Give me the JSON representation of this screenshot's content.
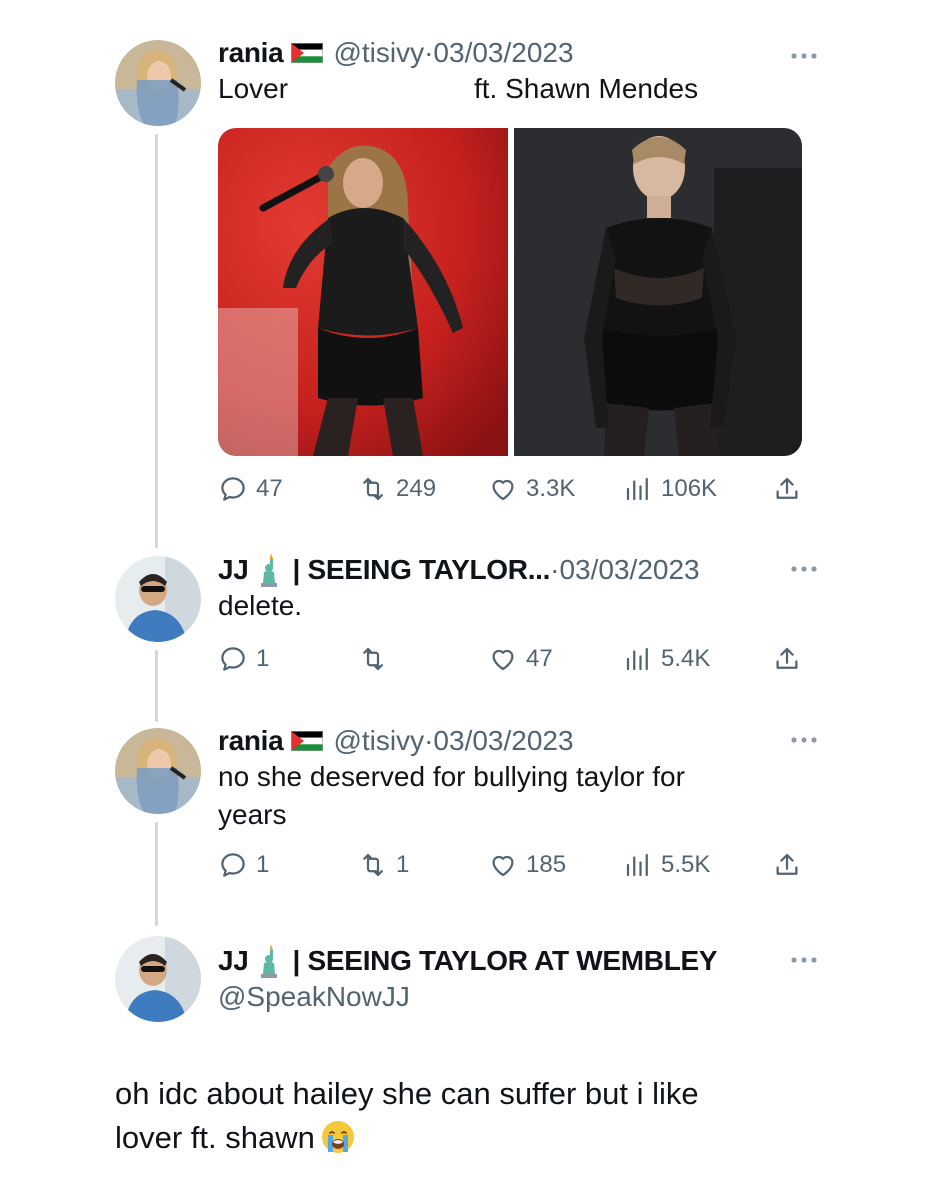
{
  "tweet1": {
    "name": "rania",
    "handle": "@tisivy",
    "separator": "·",
    "date": "03/03/2023",
    "text_left": "Lover",
    "text_right": "ft. Shawn Mendes",
    "replies": "47",
    "retweets": "249",
    "likes": "3.3K",
    "views": "106K"
  },
  "tweet2": {
    "name": "JJ",
    "display_suffix": "| SEEING TAYLOR...",
    "separator": "·",
    "date": "03/03/2023",
    "text": "delete.",
    "replies": "1",
    "retweets": "",
    "likes": "47",
    "views": "5.4K"
  },
  "tweet3": {
    "name": "rania",
    "handle": "@tisivy",
    "separator": "·",
    "date": "03/03/2023",
    "text_line1": "no she deserved for bullying taylor for",
    "text_line2": "years",
    "replies": "1",
    "retweets": "1",
    "likes": "185",
    "views": "5.5K"
  },
  "tweet4": {
    "name": "JJ",
    "display_suffix": "| SEEING TAYLOR AT WEMBLEY",
    "handle": "@SpeakNowJJ"
  },
  "main_text": {
    "line1": "oh idc about hailey she can suffer but i like",
    "line2": "lover ft. shawn"
  },
  "colors": {
    "text": "#0f1419",
    "secondary": "#536471",
    "thread_line": "#cfd9de"
  },
  "icons": [
    "reply-icon",
    "retweet-icon",
    "like-icon",
    "views-icon",
    "share-icon",
    "more-icon",
    "palestine-flag-icon",
    "statue-of-liberty-icon",
    "crying-face-emoji"
  ]
}
